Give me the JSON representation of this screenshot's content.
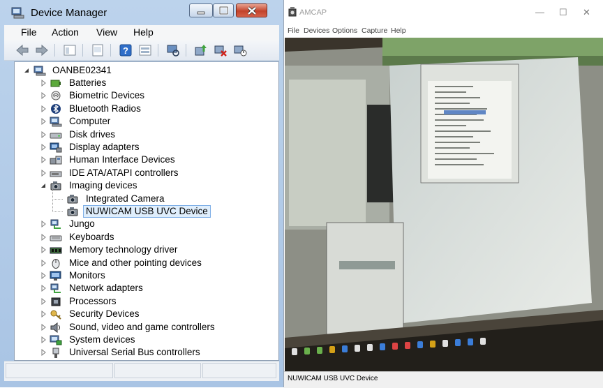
{
  "device_manager": {
    "title": "Device Manager",
    "menu": [
      "File",
      "Action",
      "View",
      "Help"
    ],
    "toolbar_icons": [
      "back-icon",
      "forward-icon",
      "show-hide-icon",
      "properties-icon",
      "help-icon",
      "view-icon",
      "scan-hardware-icon",
      "update-driver-icon",
      "uninstall-icon",
      "disable-icon"
    ],
    "tree": {
      "root": "OANBE02341",
      "items": [
        {
          "label": "Batteries",
          "icon": "battery-icon"
        },
        {
          "label": "Biometric Devices",
          "icon": "biometric-icon"
        },
        {
          "label": "Bluetooth Radios",
          "icon": "bluetooth-icon"
        },
        {
          "label": "Computer",
          "icon": "computer-icon"
        },
        {
          "label": "Disk drives",
          "icon": "disk-drive-icon"
        },
        {
          "label": "Display adapters",
          "icon": "display-adapter-icon"
        },
        {
          "label": "Human Interface Devices",
          "icon": "hid-icon"
        },
        {
          "label": "IDE ATA/ATAPI controllers",
          "icon": "ide-controller-icon"
        },
        {
          "label": "Imaging devices",
          "icon": "camera-icon",
          "expanded": true
        },
        {
          "label": "Integrated Camera",
          "icon": "camera-icon",
          "child": true
        },
        {
          "label": "NUWICAM USB UVC Device",
          "icon": "camera-icon",
          "child": true,
          "selected": true
        },
        {
          "label": "Jungo",
          "icon": "network-icon"
        },
        {
          "label": "Keyboards",
          "icon": "keyboard-icon"
        },
        {
          "label": "Memory technology driver",
          "icon": "memory-icon"
        },
        {
          "label": "Mice and other pointing devices",
          "icon": "mouse-icon"
        },
        {
          "label": "Monitors",
          "icon": "monitor-icon"
        },
        {
          "label": "Network adapters",
          "icon": "network-icon"
        },
        {
          "label": "Processors",
          "icon": "processor-icon"
        },
        {
          "label": "Security Devices",
          "icon": "security-key-icon"
        },
        {
          "label": "Sound, video and game controllers",
          "icon": "speaker-icon"
        },
        {
          "label": "System devices",
          "icon": "system-devices-icon"
        },
        {
          "label": "Universal Serial Bus controllers",
          "icon": "usb-icon"
        }
      ]
    }
  },
  "amcap": {
    "title": "AMCAP",
    "menu": [
      "File",
      "Devices",
      "Options",
      "Capture",
      "Help"
    ],
    "status": "NUWICAM USB UVC Device"
  },
  "colors": {
    "selection": "#dfeefc",
    "window_frame": "#b3cbe8",
    "close_button": "#c2432b"
  }
}
